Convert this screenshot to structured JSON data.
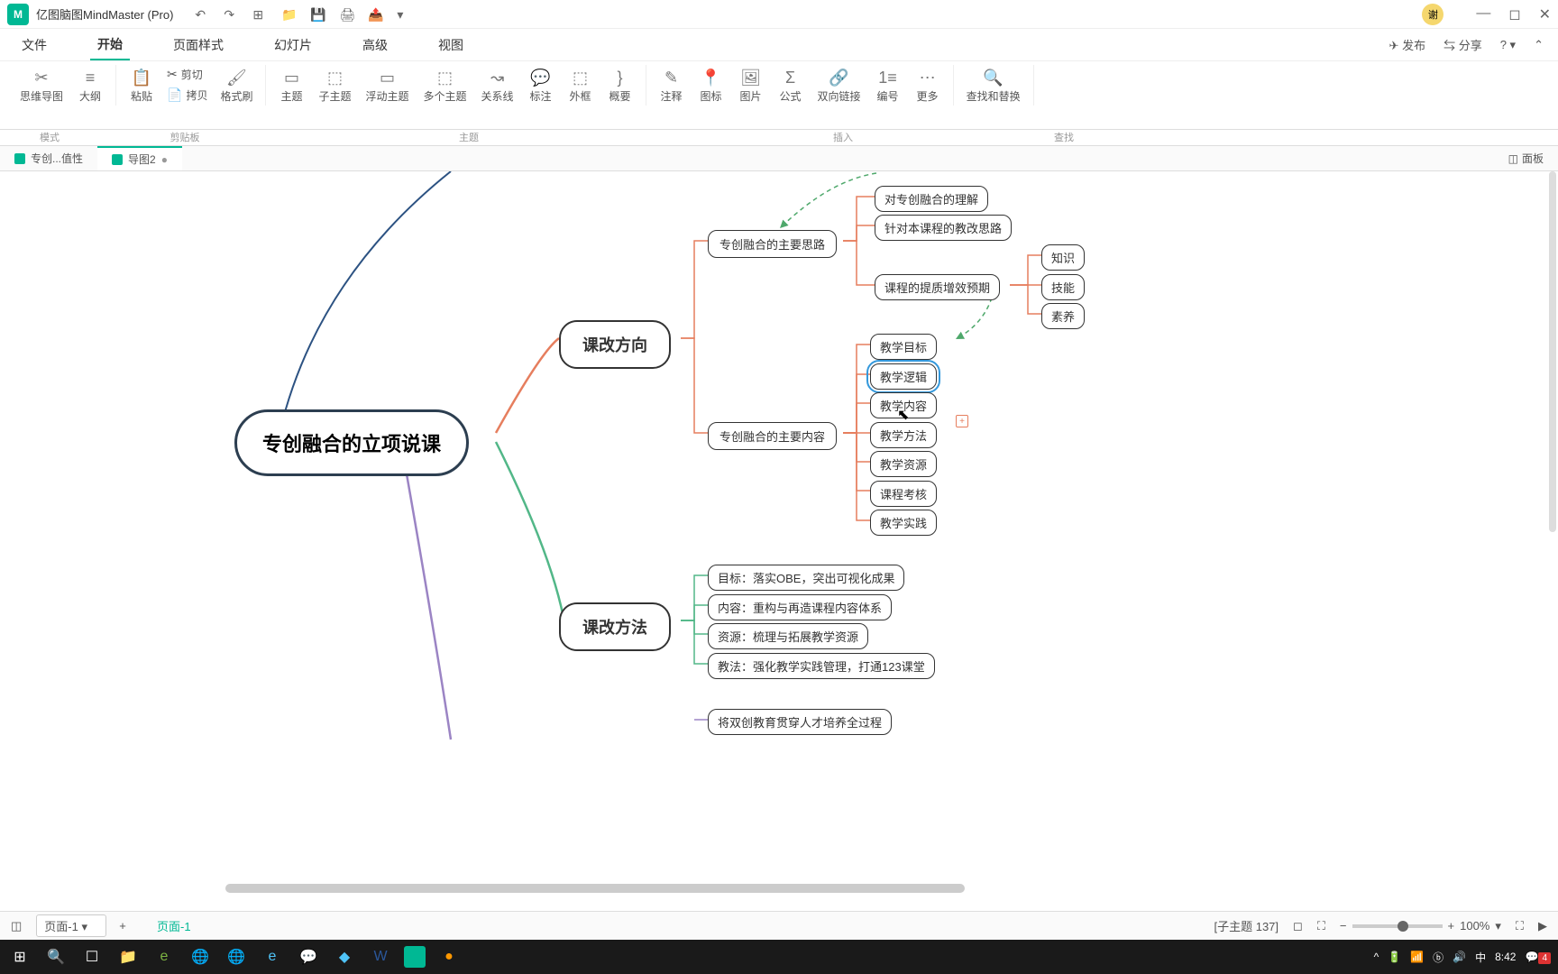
{
  "app": {
    "title": "亿图脑图MindMaster (Pro)",
    "user_avatar": "谢"
  },
  "menu": {
    "items": [
      "文件",
      "开始",
      "页面样式",
      "幻灯片",
      "高级",
      "视图"
    ],
    "active_index": 1,
    "right": {
      "publish": "发布",
      "share": "分享"
    }
  },
  "ribbon": {
    "mode": {
      "mindmap": "思维导图",
      "outline": "大纲",
      "label": "模式"
    },
    "clipboard": {
      "paste": "粘贴",
      "cut": "剪切",
      "copy": "拷贝",
      "format": "格式刷",
      "label": "剪贴板"
    },
    "topic": {
      "topic": "主题",
      "subtopic": "子主题",
      "floating": "浮动主题",
      "multiple": "多个主题",
      "relation": "关系线",
      "callout": "标注",
      "boundary": "外框",
      "summary": "概要",
      "label": "主题"
    },
    "insert": {
      "note": "注释",
      "icon": "图标",
      "image": "图片",
      "formula": "公式",
      "link": "双向链接",
      "number": "编号",
      "more": "更多",
      "label": "插入"
    },
    "find": {
      "findreplace": "查找和替换",
      "label": "查找"
    }
  },
  "tabs": {
    "items": [
      {
        "label": "专创...值性",
        "active": false
      },
      {
        "label": "导图2",
        "active": true,
        "modified": true
      }
    ],
    "panel": "面板"
  },
  "mindmap": {
    "root": "专创融合的立项说课",
    "branches": [
      {
        "label": "课改方向",
        "color": "red",
        "children": [
          {
            "label": "专创融合的主要思路",
            "children": [
              {
                "label": "对专创融合的理解"
              },
              {
                "label": "针对本课程的教改思路"
              },
              {
                "label": "课程的提质增效预期",
                "children": [
                  {
                    "label": "知识"
                  },
                  {
                    "label": "技能"
                  },
                  {
                    "label": "素养"
                  }
                ]
              }
            ]
          },
          {
            "label": "专创融合的主要内容",
            "children": [
              {
                "label": "教学目标"
              },
              {
                "label": "教学逻辑",
                "selected": true
              },
              {
                "label": "教学内容"
              },
              {
                "label": "教学方法"
              },
              {
                "label": "教学资源"
              },
              {
                "label": "课程考核"
              },
              {
                "label": "教学实践"
              }
            ]
          }
        ]
      },
      {
        "label": "课改方法",
        "color": "green",
        "children": [
          {
            "label": "目标：落实OBE，突出可视化成果"
          },
          {
            "label": "内容：重构与再造课程内容体系"
          },
          {
            "label": "资源：梳理与拓展教学资源"
          },
          {
            "label": "教法：强化教学实践管理，打通123课堂"
          }
        ]
      },
      {
        "label": "",
        "color": "purple",
        "children": [
          {
            "label": "将双创教育贯穿人才培养全过程"
          }
        ]
      }
    ]
  },
  "statusbar": {
    "page_dropdown": "页面-1",
    "page_tab": "页面-1",
    "selection": "[子主题 137]",
    "zoom": "100%"
  },
  "taskbar": {
    "time": "8:42",
    "date": "",
    "ime": "中",
    "notif_count": "4"
  }
}
